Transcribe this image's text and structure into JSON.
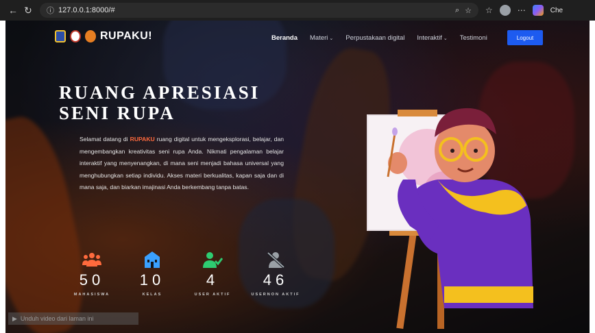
{
  "browser": {
    "url": "127.0.0.1:8000/#",
    "profile_name": "Che"
  },
  "header": {
    "brand": "RUPAKU!",
    "nav": [
      {
        "label": "Beranda",
        "active": true,
        "dropdown": false
      },
      {
        "label": "Materi",
        "active": false,
        "dropdown": true
      },
      {
        "label": "Perpustakaan digital",
        "active": false,
        "dropdown": false
      },
      {
        "label": "Interaktif",
        "active": false,
        "dropdown": true
      },
      {
        "label": "Testimoni",
        "active": false,
        "dropdown": false
      }
    ],
    "logout_label": "Logout"
  },
  "hero": {
    "title_line1": "RUANG APRESIASI",
    "title_line2": "SENI RUPA",
    "desc_before": "Selamat datang di ",
    "desc_brand": "RUPAKU",
    "desc_after": " ruang digital untuk mengeksplorasi, belajar, dan mengembangkan kreativitas seni rupa Anda. Nikmati pengalaman belajar interaktif yang menyenangkan, di mana seni menjadi bahasa universal yang menghubungkan setiap individu. Akses materi berkualitas, kapan saja dan di mana saja, dan biarkan imajinasi Anda berkembang tanpa batas."
  },
  "stats": [
    {
      "icon": "users-icon",
      "value": "50",
      "label": "MAHASISWA",
      "color": "#ff6a3d"
    },
    {
      "icon": "school-icon",
      "value": "10",
      "label": "KELAS",
      "color": "#3aa0ff"
    },
    {
      "icon": "user-check-icon",
      "value": "4",
      "label": "USER AKTIF",
      "color": "#2ecc71"
    },
    {
      "icon": "user-slash-icon",
      "value": "46",
      "label": "USERNON AKTIF",
      "color": "#9aa0a6"
    }
  ],
  "download_bar": {
    "label": "Unduh video dari laman ini"
  },
  "colors": {
    "accent": "#1d5bf0",
    "brand": "#ff6a3d"
  }
}
